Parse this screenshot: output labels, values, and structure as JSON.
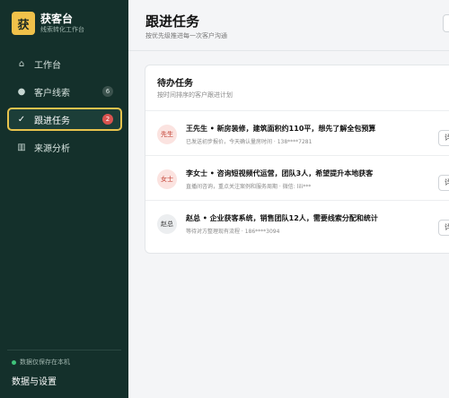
{
  "brand": {
    "logo": "获",
    "name": "获客台",
    "subtitle": "线索转化工作台"
  },
  "sidebar": {
    "items": [
      {
        "label": "工作台",
        "icon": "home-icon"
      },
      {
        "label": "客户线索",
        "icon": "dot-icon",
        "badge": "6"
      },
      {
        "label": "跟进任务",
        "icon": "check-icon",
        "badge": "2",
        "active": true
      },
      {
        "label": "来源分析",
        "icon": "bars-icon"
      }
    ],
    "status": "数据仅保存在本机",
    "settings": "数据与设置"
  },
  "header": {
    "title": "跟进任务",
    "subtitle": "按优先级推进每一次客户沟通"
  },
  "card": {
    "title": "待办任务",
    "subtitle": "按时间排序的客户跟进计划",
    "tasks": [
      {
        "avatar": "先生",
        "title": "王先生 • 新房装修，建筑面积约110平，想先了解全包预算",
        "meta": "已发送初步报价，今天确认量房时间 · 138****7281",
        "action": "详"
      },
      {
        "avatar": "女士",
        "title": "李女士 • 咨询短视频代运营，团队3人，希望提升本地获客",
        "meta": "直播间咨询，重点关注案例和服务周期 · 微信: lili***",
        "action": "详"
      },
      {
        "avatar": "赵总",
        "title": "赵总 • 企业获客系统，销售团队12人，需要线索分配和统计",
        "meta": "等待对方整理现有流程 · 186****3094",
        "action": "详"
      }
    ]
  },
  "colors": {
    "sidebar_bg": "#14302b",
    "accent": "#e7c34d",
    "badge_red": "#d9534f",
    "status_green": "#3fc37a"
  }
}
